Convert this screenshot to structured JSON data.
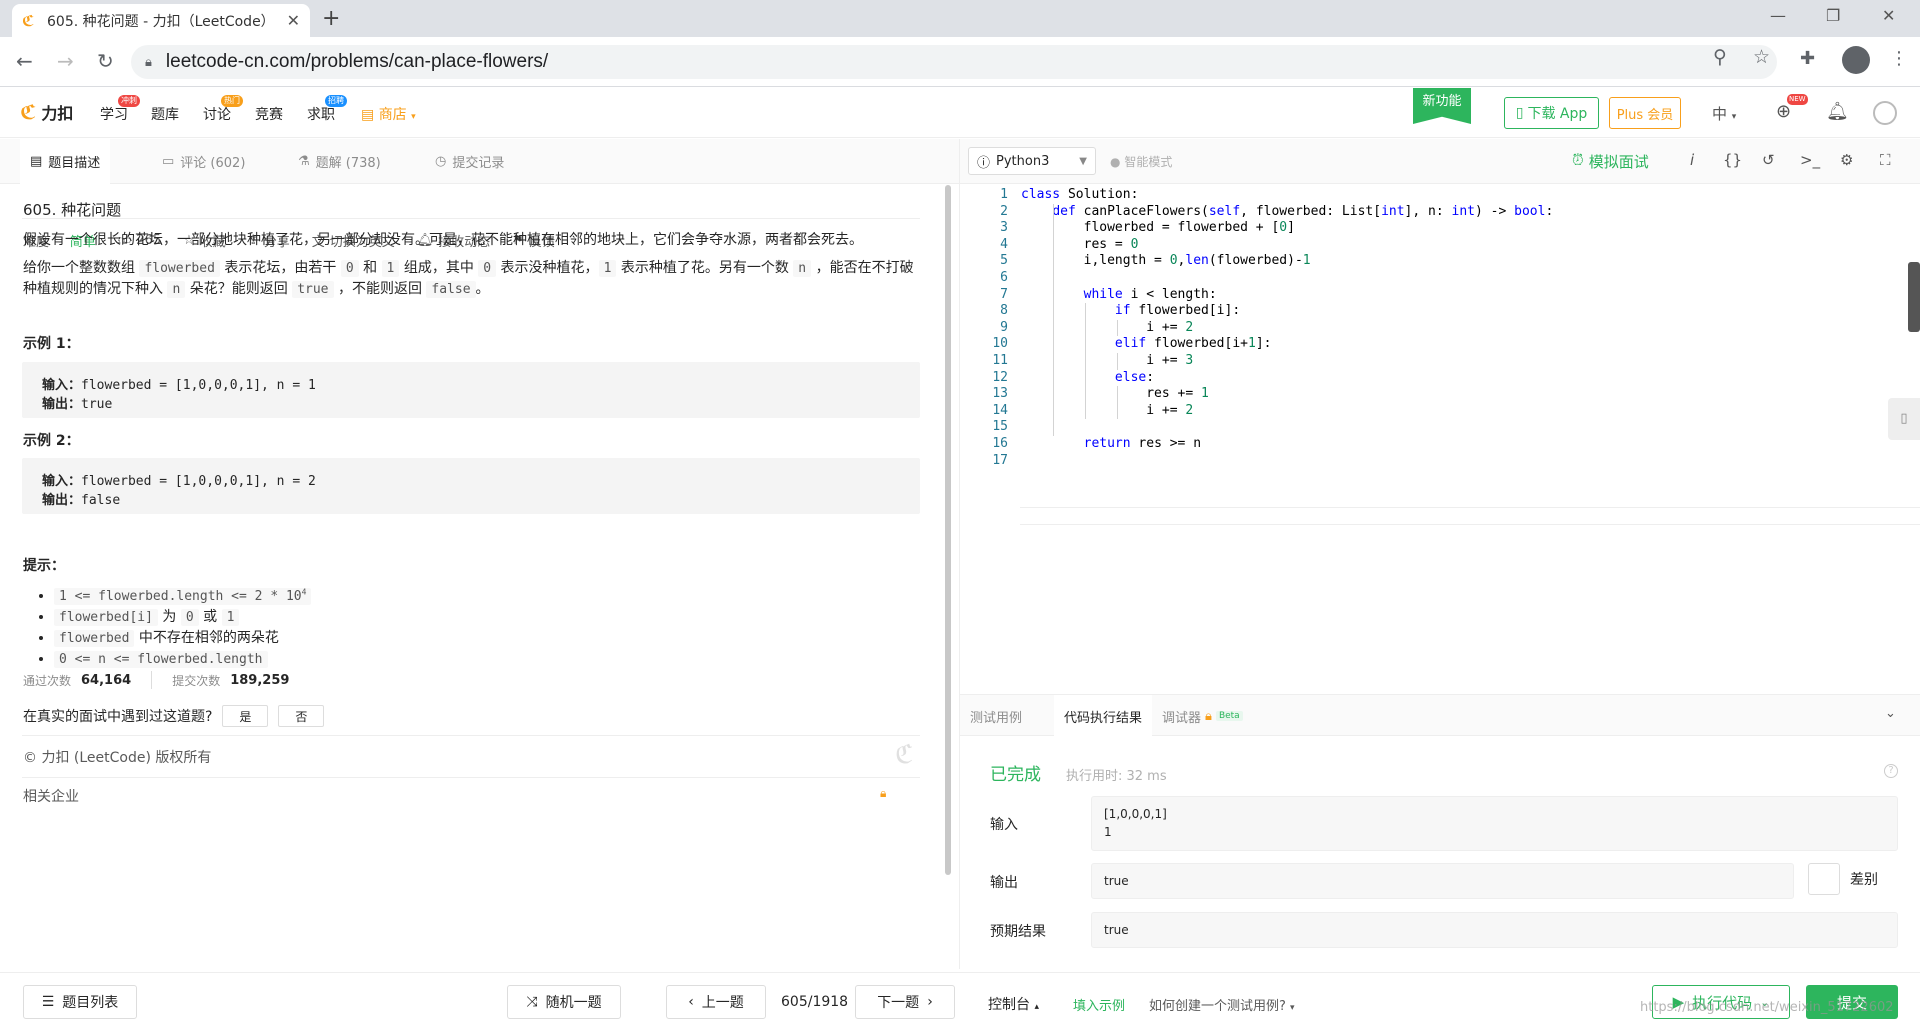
{
  "browser": {
    "tab_title": "605. 种花问题 - 力扣（LeetCode）",
    "url": "leetcode-cn.com/problems/can-place-flowers/"
  },
  "nav": {
    "logo_text": "力扣",
    "items": [
      {
        "label": "学习",
        "badge": "冲刺"
      },
      {
        "label": "题库",
        "badge": ""
      },
      {
        "label": "讨论",
        "badge": "热门"
      },
      {
        "label": "竞赛",
        "badge": ""
      },
      {
        "label": "求职",
        "badge": "招聘"
      }
    ],
    "shop": "商店",
    "new_feature": "新功能",
    "download_app": "下载 App",
    "plus": "Plus 会员",
    "lang": "中",
    "new_badge": "NEW"
  },
  "left_tabs": [
    "题目描述",
    "评论 (602)",
    "题解 (738)",
    "提交记录"
  ],
  "problem": {
    "title": "605. 种花问题",
    "difficulty_label": "难度",
    "difficulty": "简单",
    "likes": "265",
    "actions": [
      "收藏",
      "分享",
      "切换为英文",
      "接收动态",
      "反馈"
    ],
    "p1": "假设有一个很长的花坛，一部分地块种植了花，另一部分却没有。可是，花不能种植在相邻的地块上，它们会争夺水源，两者都会死去。",
    "p2": {
      "a": "给你一个整数数组 ",
      "code1": "flowerbed",
      "b": " 表示花坛，由若干 ",
      "code2": "0",
      "c": " 和 ",
      "code3": "1",
      "d": " 组成，其中 ",
      "code4": "0",
      "e": " 表示没种植花，",
      "code5": "1",
      "f": " 表示种植了花。另有一个数 ",
      "code6": "n",
      "g": " ，能否在不打破种植规则的情况下种入 ",
      "code7": "n",
      "h": " 朵花？能则返回 ",
      "code8": "true",
      "i": " ，不能则返回 ",
      "code9": "false",
      "j": "。"
    },
    "ex1_title": "示例 1：",
    "ex1_in_label": "输入：",
    "ex1_in": "flowerbed = [1,0,0,0,1], n = 1",
    "ex1_out_label": "输出：",
    "ex1_out": "true",
    "ex2_title": "示例 2：",
    "ex2_in_label": "输入：",
    "ex2_in": "flowerbed = [1,0,0,0,1], n = 2",
    "ex2_out_label": "输出：",
    "ex2_out": "false",
    "hint_title": "提示：",
    "hints": {
      "h1": "1 <= flowerbed.length <= 2 * 10",
      "h1_sup": "4",
      "h2_code": "flowerbed[i]",
      "h2_mid": " 为 ",
      "h2_a": "0",
      "h2_or": " 或 ",
      "h2_b": "1",
      "h3_code": "flowerbed",
      "h3_text": " 中不存在相邻的两朵花",
      "h4": "0 <= n <= flowerbed.length"
    },
    "accepted_label": "通过次数",
    "accepted": "64,164",
    "submissions_label": "提交次数",
    "submissions": "189,259",
    "interview_q": "在真实的面试中遇到过这道题?",
    "yes": "是",
    "no": "否",
    "copyright": "© 力扣 (LeetCode) 版权所有",
    "related": "相关企业"
  },
  "editor": {
    "language": "Python3",
    "smart_mode": "智能模式",
    "mock_interview": "模拟面试",
    "lines": [
      "class Solution:",
      "    def canPlaceFlowers(self, flowerbed: List[int], n: int) -> bool:",
      "        flowerbed = flowerbed + [0]",
      "        res = 0",
      "        i,length = 0,len(flowerbed)-1",
      "",
      "        while i < length:",
      "            if flowerbed[i]:",
      "                i += 2",
      "            elif flowerbed[i+1]:",
      "                i += 3",
      "            else:",
      "                res += 1",
      "                i += 2",
      "",
      "        return res >= n",
      ""
    ]
  },
  "console": {
    "tabs": [
      "测试用例",
      "代码执行结果",
      "调试器"
    ],
    "beta": "Beta",
    "status": "已完成",
    "runtime": "执行用时: 32 ms",
    "input_label": "输入",
    "input_line1": "[1,0,0,0,1]",
    "input_line2": "1",
    "output_label": "输出",
    "output": "true",
    "expected_label": "预期结果",
    "expected": "true",
    "diff": "差别"
  },
  "bottom": {
    "problem_list": "题目列表",
    "random": "随机一题",
    "prev": "上一题",
    "page": "605/1918",
    "next": "下一题",
    "console": "控制台",
    "fill_example": "填入示例",
    "how_to": "如何创建一个测试用例?",
    "run": "执行代码",
    "submit": "提交",
    "watermark": "https://blog.csdn.net/weixin_51722602"
  }
}
